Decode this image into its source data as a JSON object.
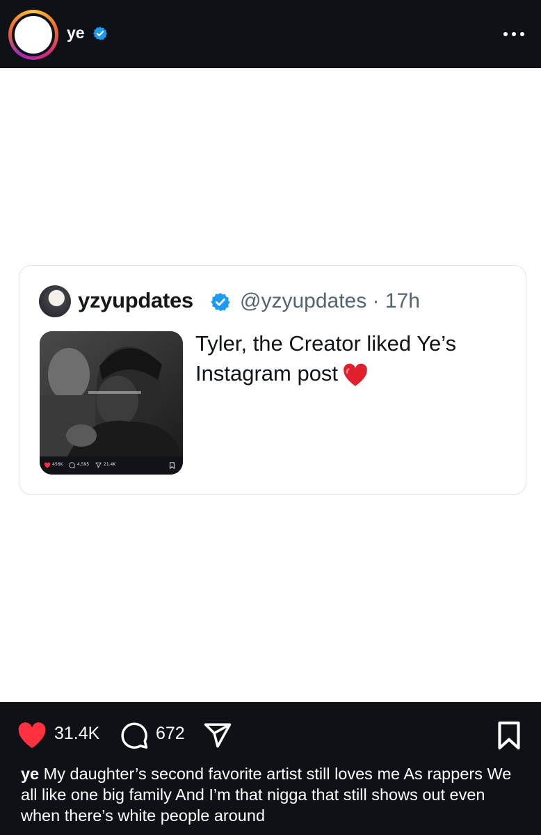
{
  "header": {
    "username": "ye",
    "verified_icon": "verified-badge-icon",
    "more_icon": "more-horizontal-icon"
  },
  "quoted_post": {
    "display_name": "yzyupdates",
    "handle_time": "@yzyupdates · 17h",
    "text": "Tyler, the Creator liked Ye’s Instagram post",
    "emoji": "red-heart-icon",
    "thumbnail": {
      "likes": "456K",
      "comments": "4,595",
      "shares": "21.4K"
    }
  },
  "actions": {
    "likes": "31.4K",
    "comments": "672"
  },
  "caption": {
    "username": "ye",
    "text": "My daughter’s second favorite artist still loves me  As rappers  We all like one big family  And I’m that nigga that still shows out even when there’s white people around"
  },
  "colors": {
    "header_bg": "#0e1116",
    "verified_blue": "#1d9bf0",
    "like_red": "#ff3040",
    "handle_gray": "#536471"
  }
}
